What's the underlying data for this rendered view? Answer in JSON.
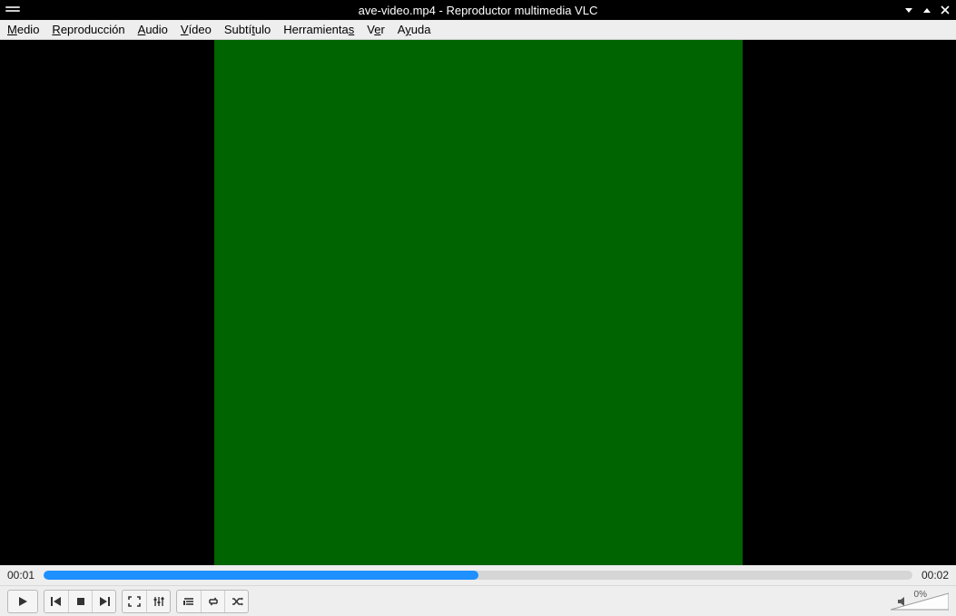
{
  "titlebar": {
    "title": "ave-video.mp4 - Reproductor multimedia VLC"
  },
  "menu": {
    "items": [
      {
        "pre": "",
        "u": "M",
        "post": "edio"
      },
      {
        "pre": "",
        "u": "R",
        "post": "eproducción"
      },
      {
        "pre": "",
        "u": "A",
        "post": "udio"
      },
      {
        "pre": "",
        "u": "V",
        "post": "ídeo"
      },
      {
        "pre": "Subtí",
        "u": "t",
        "post": "ulo"
      },
      {
        "pre": "Herramienta",
        "u": "s",
        "post": ""
      },
      {
        "pre": "V",
        "u": "e",
        "post": "r"
      },
      {
        "pre": "A",
        "u": "y",
        "post": "uda"
      }
    ]
  },
  "playback": {
    "elapsed": "00:01",
    "total": "00:02",
    "progress_percent": 50
  },
  "volume": {
    "percent_label": "0%",
    "level": 0
  },
  "video": {
    "frame_color": "#006400"
  }
}
